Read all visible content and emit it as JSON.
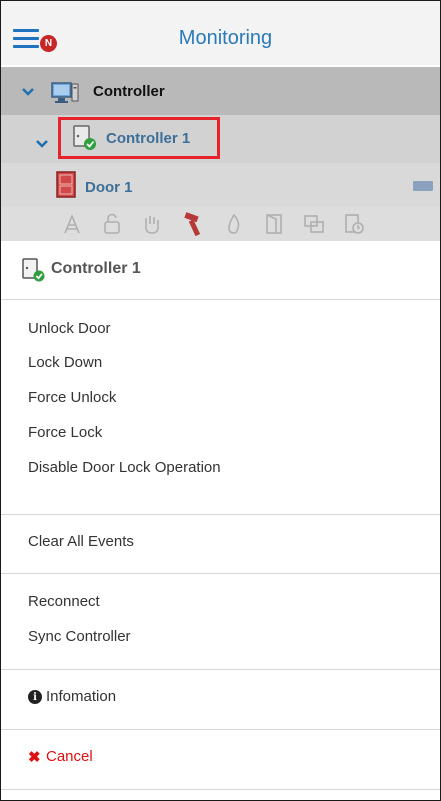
{
  "header": {
    "title": "Monitoring",
    "notification_badge": "N"
  },
  "tree": {
    "controller_group": {
      "label": "Controller"
    },
    "controller_item": {
      "label": "Controller 1"
    },
    "door_item": {
      "label": "Door 1"
    }
  },
  "sheet": {
    "title": "Controller 1",
    "groups": [
      [
        "Unlock Door",
        "Lock Down",
        "Force Unlock",
        "Force Lock",
        "Disable Door Lock Operation"
      ],
      [
        "Clear All Events"
      ],
      [
        "Reconnect",
        "Sync Controller"
      ]
    ],
    "information_label": "Infomation",
    "cancel_label": "Cancel"
  },
  "colors": {
    "accent": "#2a7ab8",
    "highlight": "#e8222a",
    "cancel": "#e01010",
    "status_ok": "#2e9e3e"
  }
}
